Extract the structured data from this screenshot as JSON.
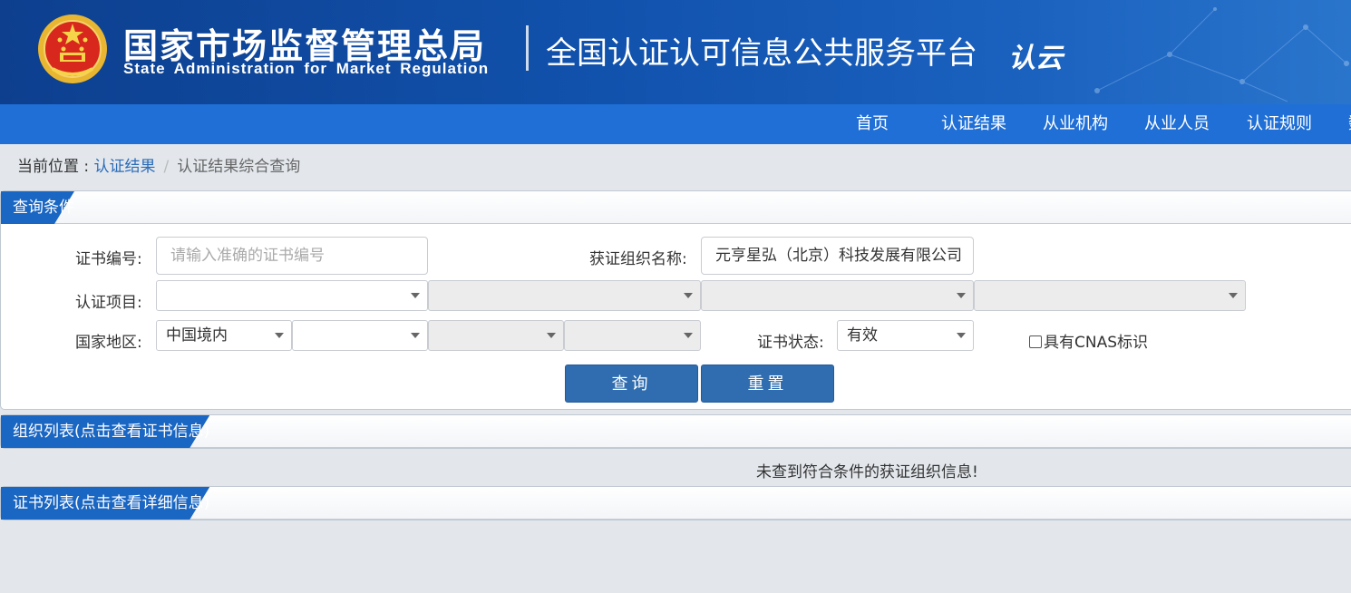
{
  "header": {
    "agency_cn": "国家市场监督管理总局",
    "agency_en": "State Administration  for  Market Regulation",
    "platform": "全国认证认可信息公共服务平台",
    "logo_text": "认云"
  },
  "nav": {
    "items": [
      "首页",
      "认证结果",
      "从业机构",
      "从业人员",
      "认证规则",
      "数"
    ]
  },
  "breadcrumb": {
    "label": "当前位置 : ",
    "link": "认证结果",
    "separator": "/",
    "current": "认证结果综合查询"
  },
  "query": {
    "title": "查询条件",
    "cert_no_label": "证书编号:",
    "cert_no_placeholder": "请输入准确的证书编号",
    "org_name_label": "获证组织名称:",
    "org_name_value": "元亨星弘（北京）科技发展有限公司",
    "project_label": "认证项目:",
    "project_selects": [
      "",
      "",
      "",
      ""
    ],
    "region_label": "国家地区:",
    "region_selects": [
      "中国境内",
      "",
      "",
      ""
    ],
    "status_label": "证书状态:",
    "status_value": "有效",
    "cnas_label": "具有CNAS标识",
    "cnas_checked": false,
    "search_button": "查询",
    "reset_button": "重置"
  },
  "org_list": {
    "title": "组织列表(点击查看证书信息)",
    "empty_message": "未查到符合条件的获证组织信息!"
  },
  "cert_list": {
    "title": "证书列表(点击查看详细信息)"
  },
  "colors": {
    "header_bg": "#1152ad",
    "nav_bg": "#1f6fd6",
    "panel_tab": "#1a66c3",
    "button": "#2f6db0",
    "link": "#2a6cb8"
  }
}
